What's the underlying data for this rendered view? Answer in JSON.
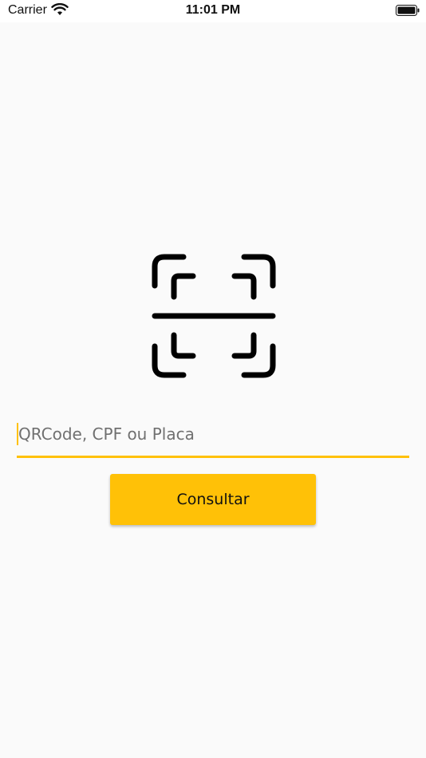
{
  "status_bar": {
    "carrier": "Carrier",
    "time": "11:01 PM",
    "wifi_icon": "wifi-icon",
    "battery_icon": "battery-icon"
  },
  "scanner": {
    "icon": "qr-scan-icon"
  },
  "search": {
    "placeholder": "QRCode, CPF ou Placa",
    "value": ""
  },
  "actions": {
    "consult_label": "Consultar"
  },
  "colors": {
    "accent": "#FFC107",
    "background": "#fafafa",
    "icon": "#000000"
  }
}
